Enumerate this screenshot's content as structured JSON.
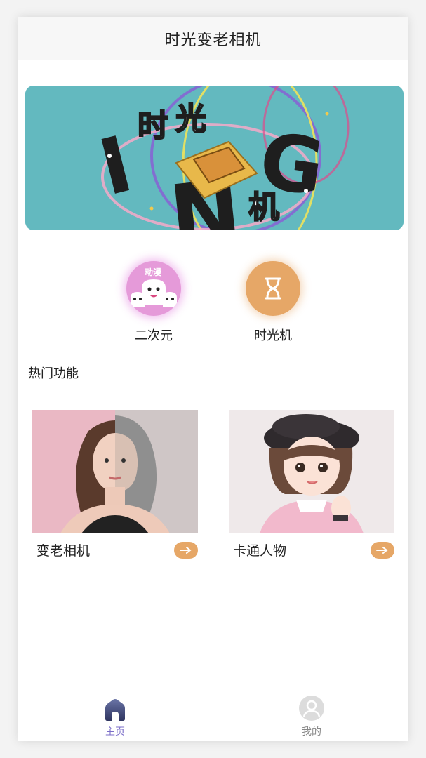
{
  "header": {
    "title": "时光变老相机"
  },
  "banner": {
    "title_chars": [
      "时",
      "光",
      "机"
    ],
    "deco_letters": [
      "I",
      "N",
      "G"
    ],
    "colors": {
      "background": "#63b9bf",
      "accent": "#f2c94c"
    }
  },
  "quick_actions": [
    {
      "label": "二次元",
      "badge": "动漫",
      "icon": "ghost-icon",
      "color": "#e59ad9"
    },
    {
      "label": "时光机",
      "icon": "hourglass-icon",
      "color": "#e6a767"
    }
  ],
  "section": {
    "title": "热门功能"
  },
  "features": [
    {
      "title": "变老相机",
      "image": "aging-portrait",
      "action_icon": "arrow-right-icon"
    },
    {
      "title": "卡通人物",
      "image": "cartoon-girl",
      "action_icon": "arrow-right-icon"
    }
  ],
  "tabbar": {
    "items": [
      {
        "label": "主页",
        "icon": "home-icon",
        "active": true
      },
      {
        "label": "我的",
        "icon": "user-icon",
        "active": false
      }
    ],
    "active_color": "#7b6ec8"
  }
}
